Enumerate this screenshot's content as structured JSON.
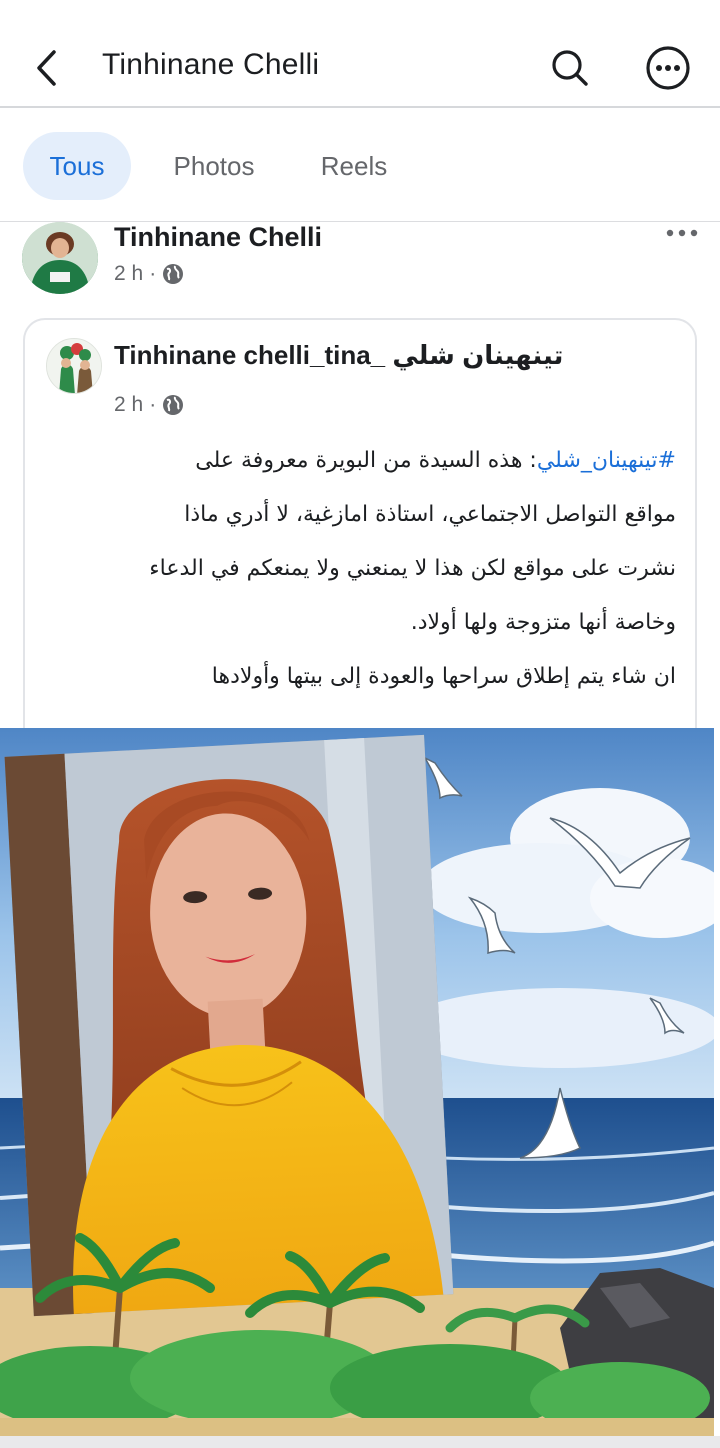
{
  "header": {
    "title": "Tinhinane Chelli",
    "back_icon": "chevron-left-icon",
    "search_icon": "search-icon",
    "more_icon": "more-circle-icon"
  },
  "tabs": [
    {
      "label": "Tous",
      "active": true
    },
    {
      "label": "Photos",
      "active": false
    },
    {
      "label": "Reels",
      "active": false
    }
  ],
  "post": {
    "author": "Tinhinane Chelli",
    "time": "2 h",
    "separator": "·",
    "audience_icon": "globe-icon",
    "menu_icon": "more-horizontal-icon"
  },
  "shared": {
    "author": "Tinhinane chelli_tina_ تينهينان شلي",
    "time": "2 h",
    "separator": "·",
    "audience_icon": "globe-icon",
    "hashtag": "#تينهينان_شلي",
    "lines": [
      ":  هذه السيدة من البويرة معروفة على",
      "مواقع التواصل الاجتماعي،  استاذة امازغية،  لا أدري ماذا",
      "نشرت على مواقع  لكن هذا لا يمنعني ولا يمنعكم في الدعاء",
      "وخاصة أنها متزوجة ولها أولاد.",
      "ان شاء يتم إطلاق سراحها والعودة إلى بيتها وأولادها"
    ]
  },
  "colors": {
    "accent": "#1b6fd8",
    "tab_active_bg": "#e4eefb",
    "muted_text": "#65676b",
    "text": "#1c1e21"
  }
}
